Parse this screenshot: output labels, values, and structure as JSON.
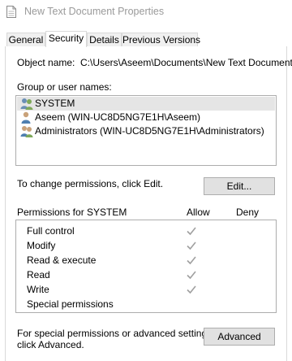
{
  "window": {
    "title": "New Text Document Properties",
    "icon": "document-icon"
  },
  "tabs": [
    {
      "label": "General",
      "active": false
    },
    {
      "label": "Security",
      "active": true
    },
    {
      "label": "Details",
      "active": false
    },
    {
      "label": "Previous Versions",
      "active": false
    }
  ],
  "object": {
    "label": "Object name:",
    "value": "C:\\Users\\Aseem\\Documents\\New Text Document"
  },
  "group_label": "Group or user names:",
  "users": [
    {
      "name": "SYSTEM",
      "icon": "system-users-icon",
      "selected": true
    },
    {
      "name": "Aseem (WIN-UC8D5NG7E1H\\Aseem)",
      "icon": "user-icon",
      "selected": false
    },
    {
      "name": "Administrators (WIN-UC8D5NG7E1H\\Administrators)",
      "icon": "group-icon",
      "selected": false
    }
  ],
  "change_perm_text": "To change permissions, click Edit.",
  "edit_button": "Edit...",
  "permissions": {
    "header": "Permissions for SYSTEM",
    "allow_label": "Allow",
    "deny_label": "Deny",
    "rows": [
      {
        "name": "Full control",
        "allow": true,
        "deny": false
      },
      {
        "name": "Modify",
        "allow": true,
        "deny": false
      },
      {
        "name": "Read & execute",
        "allow": true,
        "deny": false
      },
      {
        "name": "Read",
        "allow": true,
        "deny": false
      },
      {
        "name": "Write",
        "allow": true,
        "deny": false
      },
      {
        "name": "Special permissions",
        "allow": false,
        "deny": false
      }
    ]
  },
  "advanced": {
    "text_line1": "For special permissions or advanced settings,",
    "text_line2": "click Advanced.",
    "button": "Advanced"
  },
  "colors": {
    "check": "#a0a0a0",
    "selected_row": "#e5e5e5",
    "title_text": "#9a9a9a"
  }
}
